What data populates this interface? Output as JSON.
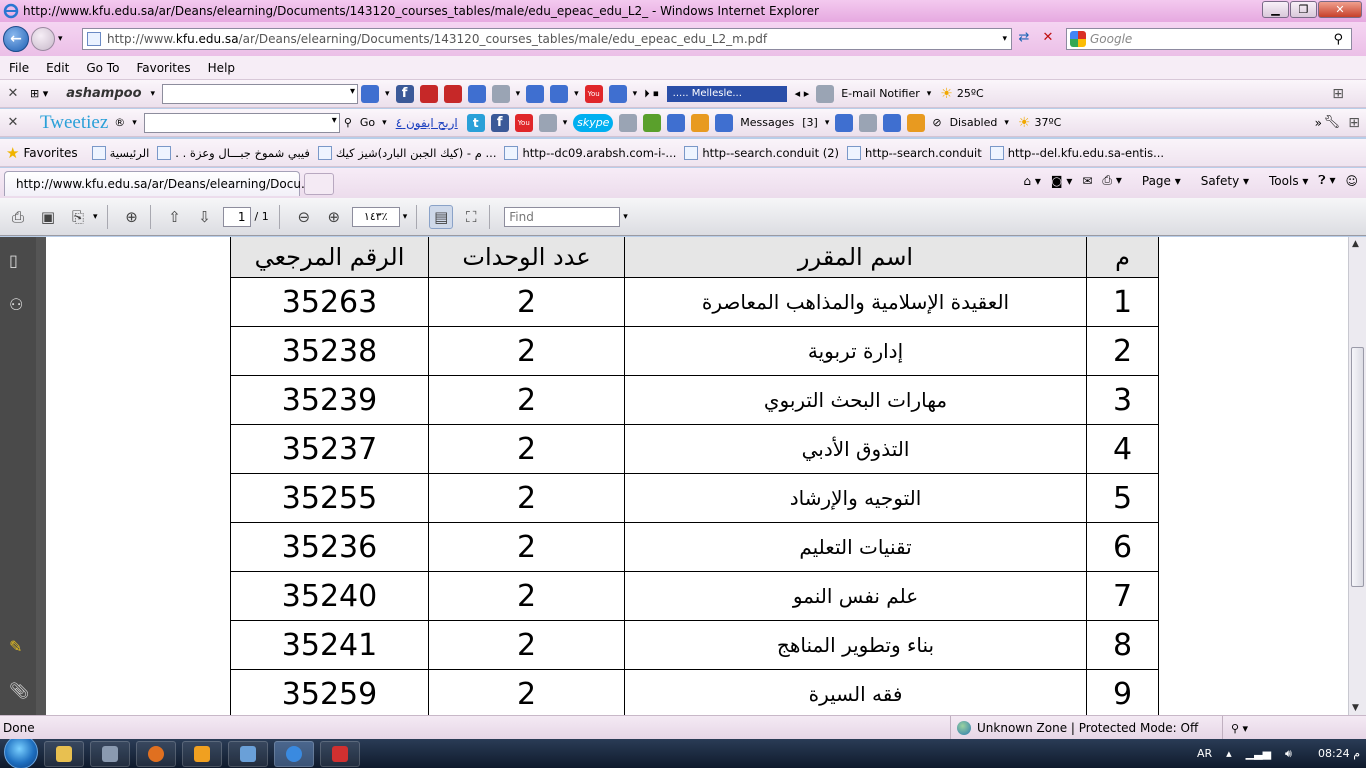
{
  "window": {
    "title": "http://www.kfu.edu.sa/ar/Deans/elearning/Documents/143120_courses_tables/male/edu_epeac_edu_L2_ - Windows Internet Explorer"
  },
  "address": {
    "url_prefix": "http://www.",
    "url_domain": "kfu.edu.sa",
    "url_rest": "/ar/Deans/elearning/Documents/143120_courses_tables/male/edu_epeac_edu_L2_m.pdf",
    "search_placeholder": "Google"
  },
  "menu": [
    "File",
    "Edit",
    "Go To",
    "Favorites",
    "Help"
  ],
  "toolbar1": {
    "brand": "ashampoo",
    "radio_label": "..... Mellesle...",
    "email_notifier": "E-mail Notifier",
    "weather": "25ºC"
  },
  "toolbar2": {
    "brand": "Tweetiez",
    "go_label": "Go",
    "arabic_link": "اربح ايفون ٤",
    "skype": "skype",
    "messages": "Messages",
    "messages_count": "[3]",
    "disabled": "Disabled",
    "weather": "37ºC"
  },
  "favorites_bar": {
    "label": "Favorites",
    "items": [
      "الرئيسية",
      ". . فيبي شموخ جبـــال وعزة",
      "م - (كيك الجبن البارد)شيز كيك ...",
      "http--dc09.arabsh.com-i-...",
      "http--search.conduit (2)",
      "http--search.conduit",
      "http--del.kfu.edu.sa-entis..."
    ]
  },
  "tab": {
    "title": "http://www.kfu.edu.sa/ar/Deans/elearning/Docu..."
  },
  "commandbar": [
    "Page",
    "Safety",
    "Tools"
  ],
  "pdf_toolbar": {
    "page_current": "1",
    "page_total": "/ 1",
    "zoom": "١٤٣٪",
    "find_placeholder": "Find"
  },
  "course_table": {
    "headers": {
      "index": "م",
      "name": "اسم المقرر",
      "units": "عدد الوحدات",
      "ref": "الرقم المرجعي"
    },
    "rows": [
      {
        "index": "1",
        "name": "العقيدة الإسلامية  والمذاهب المعاصرة",
        "units": "2",
        "ref": "35263"
      },
      {
        "index": "2",
        "name": "إدارة تربوية",
        "units": "2",
        "ref": "35238"
      },
      {
        "index": "3",
        "name": "مهارات البحث التربوي",
        "units": "2",
        "ref": "35239"
      },
      {
        "index": "4",
        "name": "التذوق الأدبي",
        "units": "2",
        "ref": "35237"
      },
      {
        "index": "5",
        "name": "التوجيه والإرشاد",
        "units": "2",
        "ref": "35255"
      },
      {
        "index": "6",
        "name": "تقنيات التعليم",
        "units": "2",
        "ref": "35236"
      },
      {
        "index": "7",
        "name": "علم نفس النمو",
        "units": "2",
        "ref": "35240"
      },
      {
        "index": "8",
        "name": "بناء وتطوير المناهج",
        "units": "2",
        "ref": "35241"
      },
      {
        "index": "9",
        "name": "فقه السيرة",
        "units": "2",
        "ref": "35259"
      }
    ]
  },
  "status": {
    "left": "Done",
    "zone": "Unknown Zone | Protected Mode: Off"
  },
  "taskbar": {
    "lang": "AR",
    "clock": "08:24 م"
  }
}
